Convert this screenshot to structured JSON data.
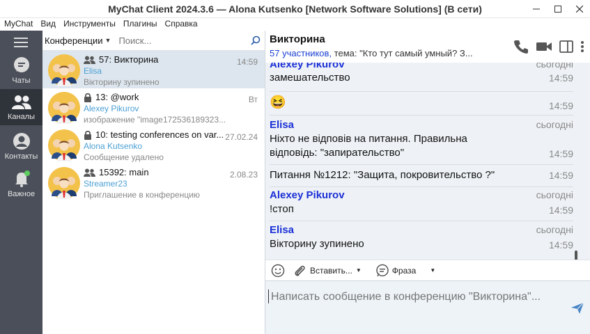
{
  "window": {
    "title": "MyChat Client 2024.3.6 — Alona Kutsenko [Network Software Solutions] (В сети)",
    "controls": [
      "minimize-icon",
      "maximize-icon",
      "close-icon"
    ]
  },
  "menu": [
    "MyChat",
    "Вид",
    "Инструменты",
    "Плагины",
    "Справка"
  ],
  "nav": {
    "items": [
      {
        "label": "Чаты",
        "icon": "chat-bubble-icon"
      },
      {
        "label": "Каналы",
        "icon": "group-icon"
      },
      {
        "label": "Контакты",
        "icon": "contact-icon"
      },
      {
        "label": "Важное",
        "icon": "bell-icon"
      }
    ]
  },
  "list": {
    "filter_label": "Конференции",
    "search_placeholder": "Поиск...",
    "conversations": [
      {
        "name": "57: Викторина",
        "user": "Elisa",
        "preview": "Вікторину зупинено",
        "time": "14:59",
        "icon": "group-icon",
        "selected": true
      },
      {
        "name": "13: @work",
        "user": "Alexey Pikurov",
        "preview": "изображение \"image172536189323...",
        "time": "Вт",
        "icon": "lock-icon"
      },
      {
        "name": "10: testing conferences on var...",
        "user": "Alona Kutsenko",
        "preview": "Сообщение удалено",
        "time": "27.02.24",
        "icon": "lock-icon"
      },
      {
        "name": "15392: main",
        "user": "Streamer23",
        "preview": "Приглашение в конференцию",
        "time": "2.08.23",
        "icon": "group-icon"
      }
    ]
  },
  "chat": {
    "title": "Викторина",
    "members": "57 участников,",
    "topic": " тема: \"Кто тут самый умный? З...",
    "messages": [
      {
        "author": "Alexey Pikurov",
        "day": "сьогодні",
        "text": "замешательство",
        "time": "14:59"
      },
      {
        "emoji": "😆",
        "time": "14:59"
      },
      {
        "author": "Elisa",
        "day": "сьогодні",
        "text": "Ніхто не відповів на питання. Правильна відповідь: \"запирательство\"",
        "time": "14:59"
      },
      {
        "text": "Питання №1212: \"Защита, покровительство ?\"",
        "time": "14:59"
      },
      {
        "author": "Alexey Pikurov",
        "day": "сьогодні",
        "text": "!стоп",
        "time": "14:59"
      },
      {
        "author": "Elisa",
        "day": "сьогодні",
        "text": "Вікторину зупинено",
        "time": "14:59"
      }
    ],
    "toolbar": {
      "insert": "Вставить...",
      "phrase": "Фраза"
    },
    "composer_placeholder": "Написать сообщение в конференцию \"Викторина\"..."
  },
  "colors": {
    "nav_bg": "#4a4f59",
    "nav_active": "#2f333a",
    "author": "#1a2fd6",
    "link": "#4a9fd5",
    "chat_bg": "#eef2f6"
  }
}
